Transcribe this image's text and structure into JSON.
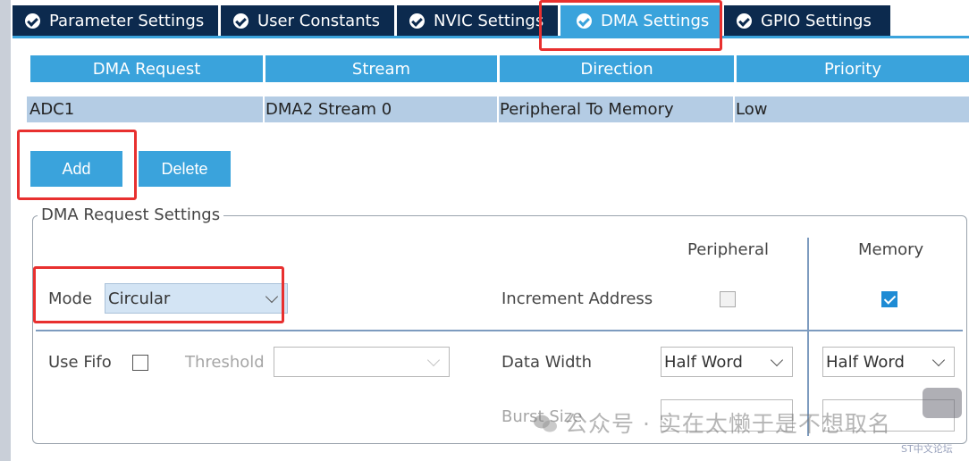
{
  "tabs": [
    {
      "label": "Parameter Settings",
      "active": false
    },
    {
      "label": "User Constants",
      "active": false
    },
    {
      "label": "NVIC Settings",
      "active": false
    },
    {
      "label": "DMA Settings",
      "active": true
    },
    {
      "label": "GPIO Settings",
      "active": false
    }
  ],
  "table": {
    "headers": [
      "DMA Request",
      "Stream",
      "Direction",
      "Priority"
    ],
    "rows": [
      [
        "ADC1",
        "DMA2 Stream 0",
        "Peripheral To Memory",
        "Low"
      ]
    ]
  },
  "buttons": {
    "add": "Add",
    "delete": "Delete"
  },
  "settings": {
    "group_title": "DMA Request Settings",
    "col_peripheral": "Peripheral",
    "col_memory": "Memory",
    "mode_label": "Mode",
    "mode_value": "Circular",
    "increment_label": "Increment Address",
    "peripheral_increment": false,
    "memory_increment": true,
    "fifo_label": "Use Fifo",
    "use_fifo": false,
    "threshold_label": "Threshold",
    "threshold_value": "",
    "data_width_label": "Data Width",
    "peripheral_data_width": "Half Word",
    "memory_data_width": "Half Word",
    "burst_label": "Burst Size"
  },
  "watermark": {
    "text": "公众号 · 实在太懒于是不想取名",
    "sub": "ST中文论坛"
  },
  "colors": {
    "tab_dark": "#0c2a4e",
    "accent": "#3aa3dc",
    "row_bg": "#b4cce4",
    "annotation": "#e8302f"
  }
}
